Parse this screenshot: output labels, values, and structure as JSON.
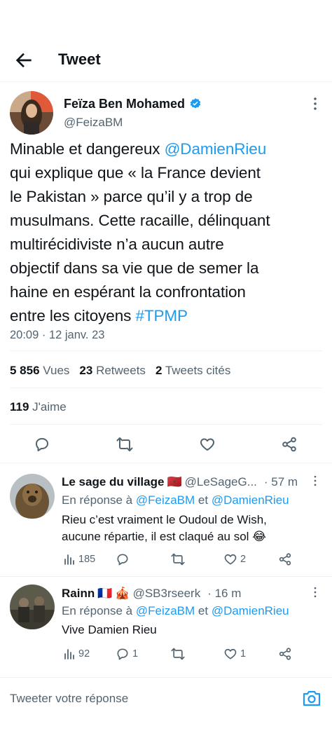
{
  "header": {
    "title": "Tweet"
  },
  "tweet": {
    "author_name": "Feïza Ben Mohamed",
    "author_handle": "@FeizaBM",
    "text_lines": [
      [
        "Minable et dangereux ",
        "@DamienRieu"
      ],
      [
        "qui explique que « la France devient",
        ""
      ],
      [
        "le Pakistan » parce qu’il y a trop de",
        ""
      ],
      [
        "musulmans. Cette racaille, délinquant",
        ""
      ],
      [
        "multirécidiviste n’a aucun autre",
        ""
      ],
      [
        "objectif dans sa vie que de semer la",
        ""
      ],
      [
        "haine en espérant la confrontation",
        ""
      ],
      [
        "entre les citoyens ",
        "#TPMP"
      ]
    ],
    "time": "20:09 · 12 janv. 23",
    "views_count": "5 856",
    "views_label": "Vues",
    "retweets_count": "23",
    "retweets_label": "Retweets",
    "quotes_count": "2",
    "quotes_label": "Tweets cités",
    "likes_count": "119",
    "likes_label": "J'aime"
  },
  "replies": [
    {
      "name": "Le sage du village",
      "flag": "🇲🇦",
      "handle": "@LeSageG...",
      "time": "· 57 m",
      "reply_to_prefix": "En réponse à ",
      "reply_to_1": "@FeizaBM",
      "reply_to_and": " et ",
      "reply_to_2": "@DamienRieu",
      "text_line_1": "Rieu c’est vraiment le Oudoul de Wish,",
      "text_line_2": "aucune répartie, il est claqué au sol 😂",
      "views": "185",
      "replies": "",
      "likes": "2"
    },
    {
      "name": "Rainn",
      "flag": "🇫🇷",
      "emoji": "🎪",
      "handle": "@SB3rseerk",
      "time": "· 16 m",
      "reply_to_prefix": "En réponse à ",
      "reply_to_1": "@FeizaBM",
      "reply_to_and": " et ",
      "reply_to_2": "@DamienRieu",
      "text_line_1": "Vive Damien Rieu",
      "views": "92",
      "replies": "1",
      "likes": "1"
    }
  ],
  "compose": {
    "placeholder": "Tweeter votre réponse"
  },
  "colors": {
    "accent": "#1d9bf0",
    "muted": "#536471",
    "text": "#0f1419",
    "divider": "#eff3f4"
  },
  "icons": [
    "back-arrow-icon",
    "verified-badge-icon",
    "more-icon",
    "reply-icon",
    "retweet-icon",
    "like-icon",
    "share-icon",
    "views-icon",
    "camera-icon"
  ]
}
